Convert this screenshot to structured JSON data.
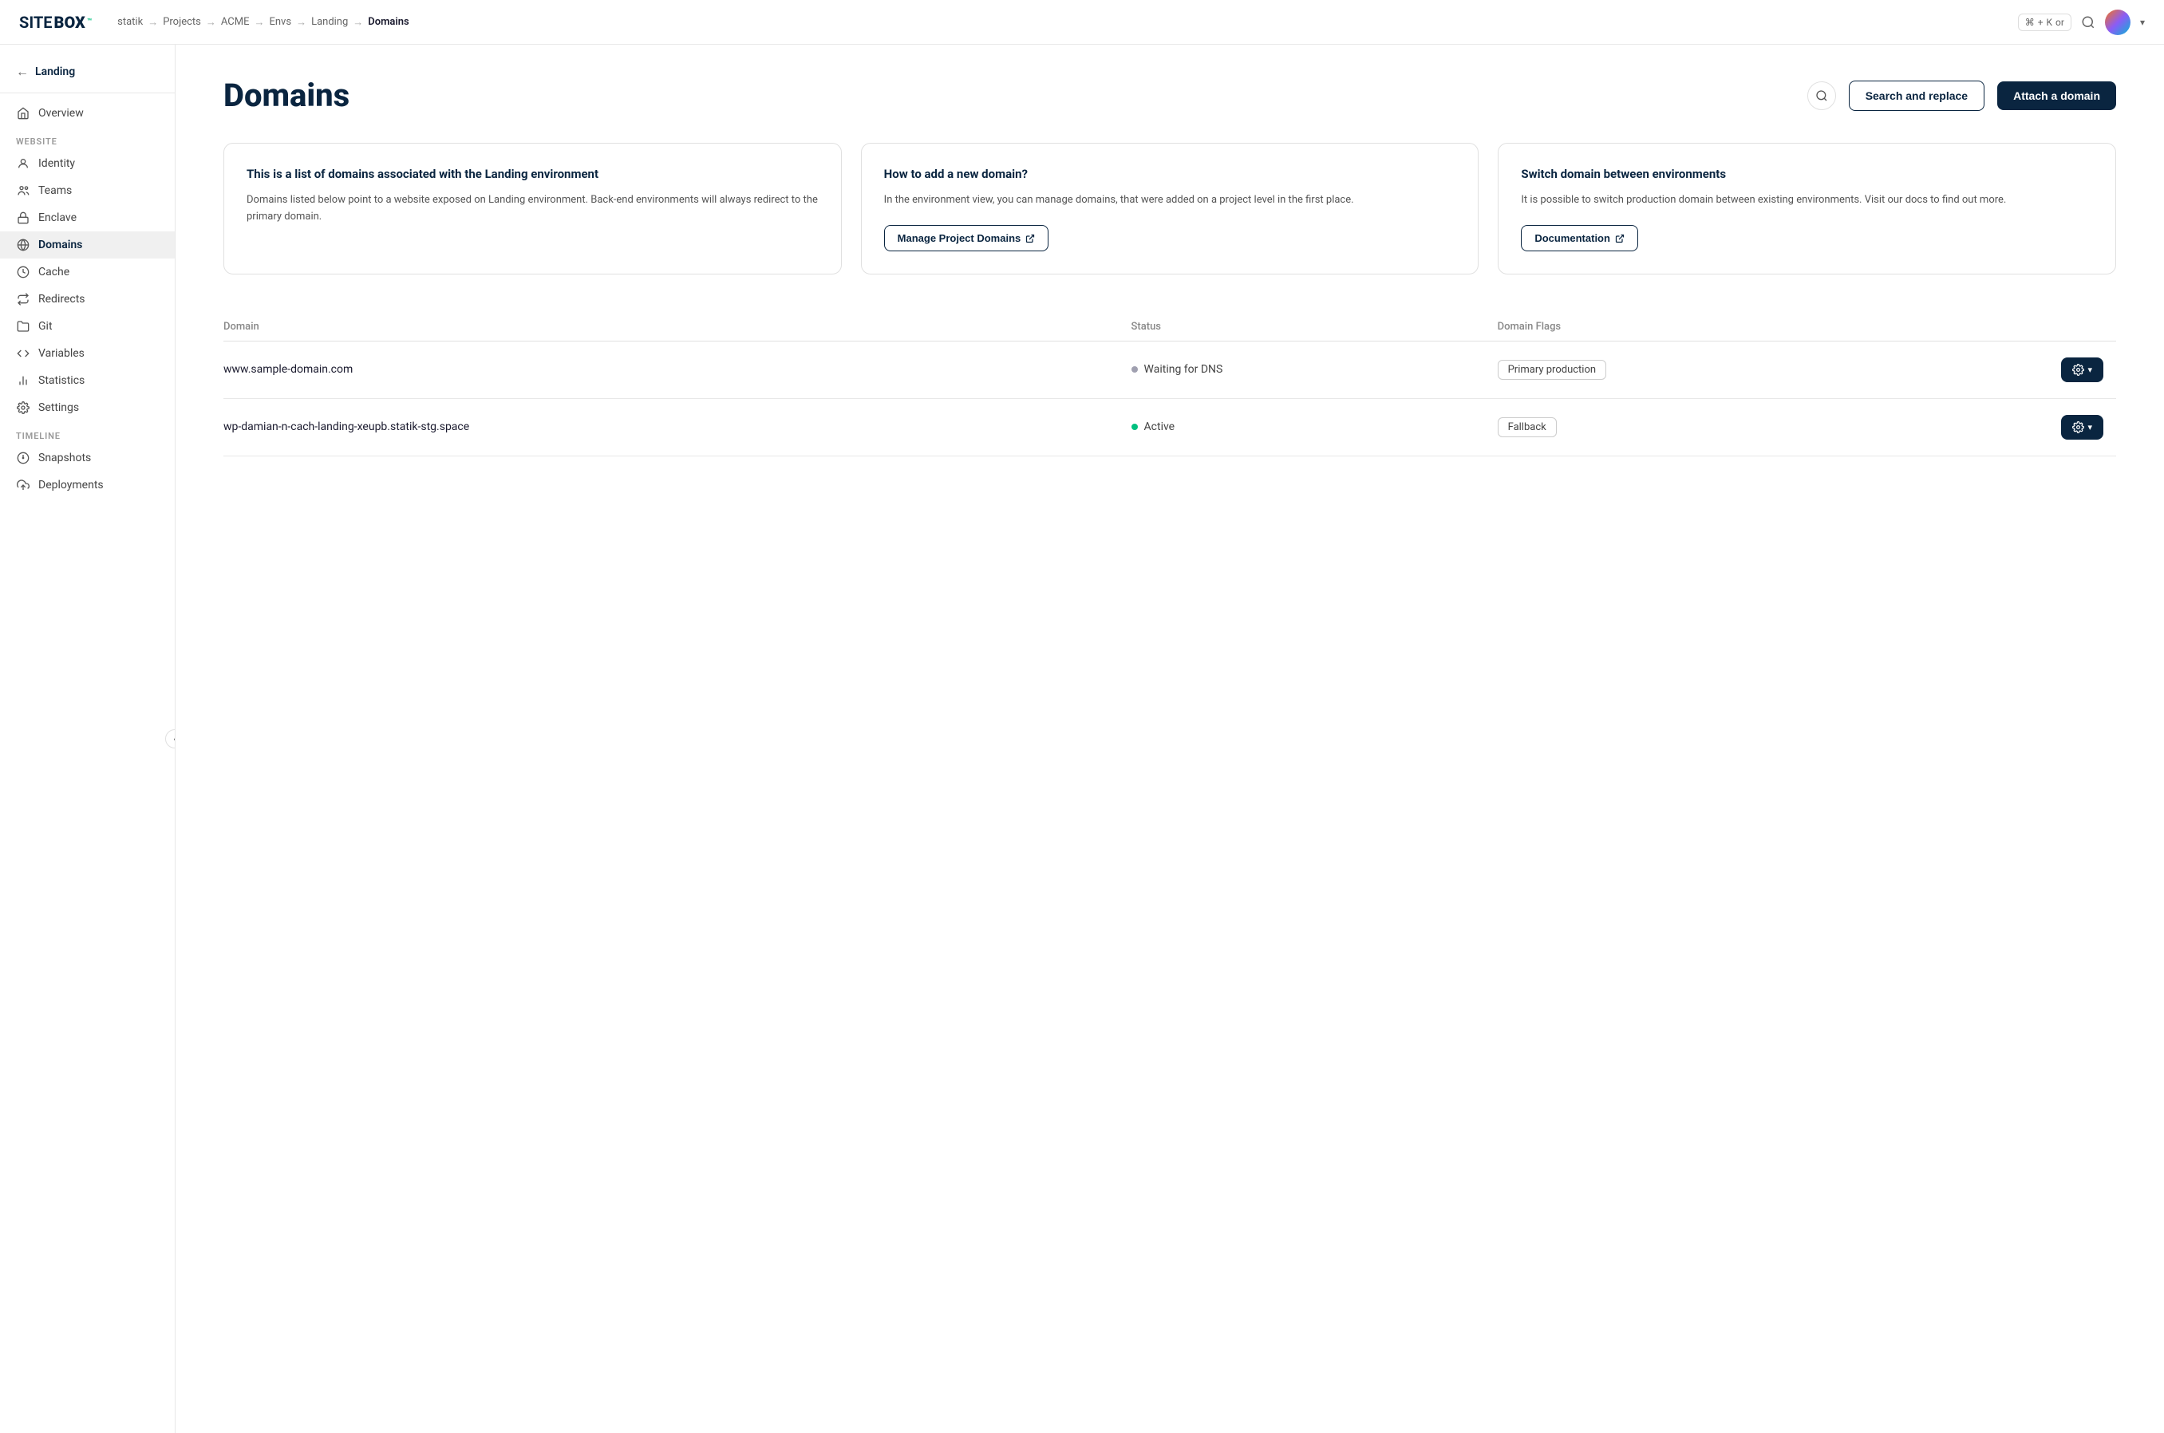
{
  "brand": {
    "name_part1": "SITE",
    "name_part2": "BOX",
    "tm": "™"
  },
  "breadcrumb": {
    "items": [
      "statik",
      "Projects",
      "ACME",
      "Envs",
      "Landing"
    ],
    "current": "Domains"
  },
  "topnav": {
    "shortcut_symbol": "⌘",
    "shortcut_plus": "+",
    "shortcut_key": "K",
    "shortcut_or": "or"
  },
  "sidebar": {
    "back_label": "Landing",
    "sections": [
      {
        "label": "WEBSITE",
        "items": [
          {
            "id": "overview",
            "label": "Overview",
            "icon": "home"
          },
          {
            "id": "identity",
            "label": "Identity",
            "icon": "person"
          },
          {
            "id": "teams",
            "label": "Teams",
            "icon": "people"
          },
          {
            "id": "enclave",
            "label": "Enclave",
            "icon": "lock"
          },
          {
            "id": "domains",
            "label": "Domains",
            "icon": "globe",
            "active": true
          },
          {
            "id": "cache",
            "label": "Cache",
            "icon": "clock"
          },
          {
            "id": "redirects",
            "label": "Redirects",
            "icon": "redirect"
          },
          {
            "id": "git",
            "label": "Git",
            "icon": "folder"
          },
          {
            "id": "variables",
            "label": "Variables",
            "icon": "code"
          },
          {
            "id": "statistics",
            "label": "Statistics",
            "icon": "chart"
          },
          {
            "id": "settings",
            "label": "Settings",
            "icon": "gear"
          }
        ]
      },
      {
        "label": "TIMELINE",
        "items": [
          {
            "id": "snapshots",
            "label": "Snapshots",
            "icon": "snapshot"
          },
          {
            "id": "deployments",
            "label": "Deployments",
            "icon": "deploy"
          }
        ]
      }
    ]
  },
  "page": {
    "title": "Domains",
    "search_and_replace_label": "Search and replace",
    "attach_domain_label": "Attach a domain"
  },
  "info_cards": [
    {
      "id": "list-info",
      "heading": "This is a list of domains associated with the Landing environment",
      "body": "Domains listed below point to a website exposed on Landing environment. Back-end environments will always redirect to the primary domain."
    },
    {
      "id": "how-to-add",
      "heading": "How to add a new domain?",
      "body": "In the environment view, you can manage domains, that were added on a project level in the first place.",
      "button_label": "Manage Project Domains",
      "button_icon": "external"
    },
    {
      "id": "switch-domain",
      "heading": "Switch domain between environments",
      "body": "It is possible to switch production domain between existing environments. Visit our docs to find out more.",
      "button_label": "Documentation",
      "button_icon": "external"
    }
  ],
  "table": {
    "columns": [
      "Domain",
      "Status",
      "Domain Flags"
    ],
    "rows": [
      {
        "domain": "www.sample-domain.com",
        "status": "Waiting for DNS",
        "status_type": "waiting",
        "flag": "Primary production",
        "flag_id": "primary-production"
      },
      {
        "domain": "wp-damian-n-cach-landing-xeupb.statik-stg.space",
        "status": "Active",
        "status_type": "active",
        "flag": "Fallback",
        "flag_id": "fallback"
      }
    ]
  }
}
